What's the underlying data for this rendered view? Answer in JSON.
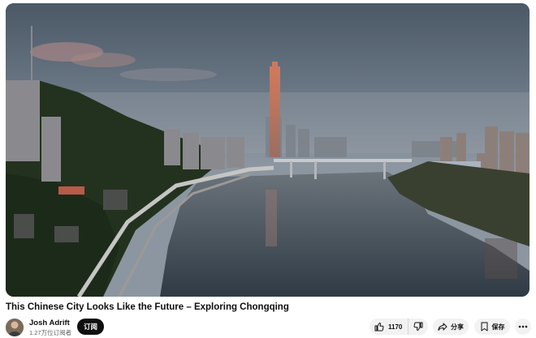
{
  "video": {
    "title": "This Chinese City Looks Like the Future – Exploring Chongqing",
    "thumbnail_icon": "city-river-aerial-image"
  },
  "channel": {
    "name": "Josh Adrift",
    "subscribers": "1.27万位订阅者",
    "avatar_icon": "avatar-photo"
  },
  "actions": {
    "subscribe_label": "订阅",
    "like_count": "1170",
    "share_label": "分享",
    "save_label": "保存",
    "like_icon": "thumbs-up-icon",
    "dislike_icon": "thumbs-down-icon",
    "share_icon": "share-arrow-icon",
    "save_icon": "bookmark-icon",
    "more_icon": "more-horizontal-icon"
  },
  "colors": {
    "subscribe_bg": "#0f0f0f",
    "pill_bg": "#f2f2f2",
    "secondary_text": "#606060"
  }
}
